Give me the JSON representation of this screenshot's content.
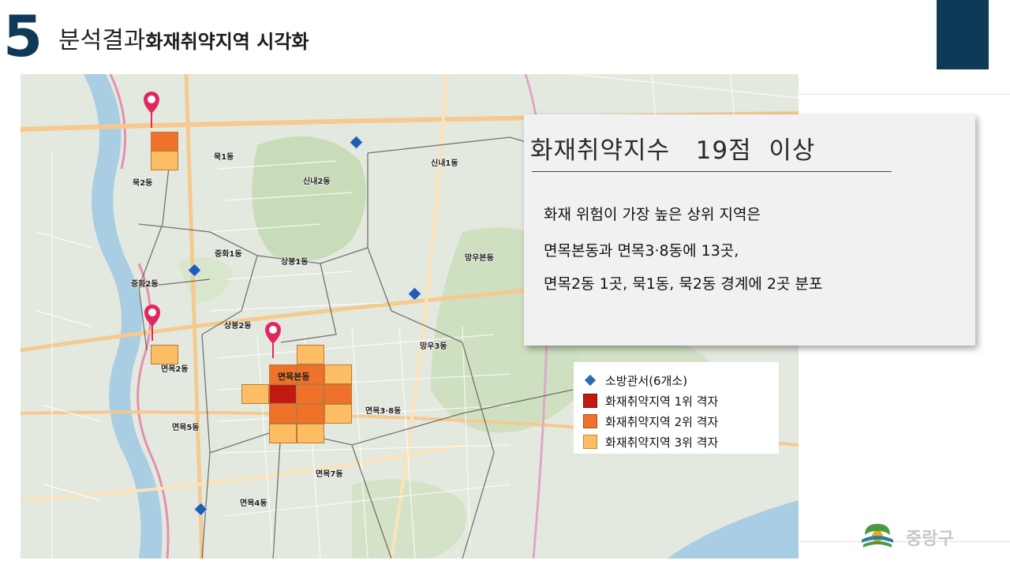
{
  "header": {
    "number": "5",
    "title": "분석결과",
    "subtitle": "화재취약지역 시각화"
  },
  "map": {
    "district_labels": [
      "묵1동",
      "묵2동",
      "신내1동",
      "신내2동",
      "중화1동",
      "상봉1동",
      "망우본동",
      "중화2동",
      "상봉2동",
      "면목2동",
      "망우3동",
      "면목본동",
      "면목3·8동",
      "면목5동",
      "면목7동",
      "면목4동"
    ],
    "pins": 3,
    "fire_stations": 6
  },
  "legend": {
    "fire_station": "소방관서(6개소)",
    "rank1": "화재취약지역 1위 격자",
    "rank2": "화재취약지역 2위 격자",
    "rank3": "화재취약지역 3위 격자",
    "colors": {
      "station": "#2b6cb7",
      "rank1": "#c01a12",
      "rank2": "#f07129",
      "rank3": "#fdbd62"
    }
  },
  "info_box": {
    "title": "화재취약지수   19점  이상",
    "lines": [
      "화재 위험이 가장 높은 상위 지역은",
      "면목본동과 면목3·8동에 13곳,",
      "면목2동 1곳, 묵1동, 묵2동 경계에  2곳 분포"
    ]
  },
  "logo": {
    "text": "중랑구",
    "icon": "jungnang-gu-logo-icon"
  },
  "accent": "#0f3a57"
}
